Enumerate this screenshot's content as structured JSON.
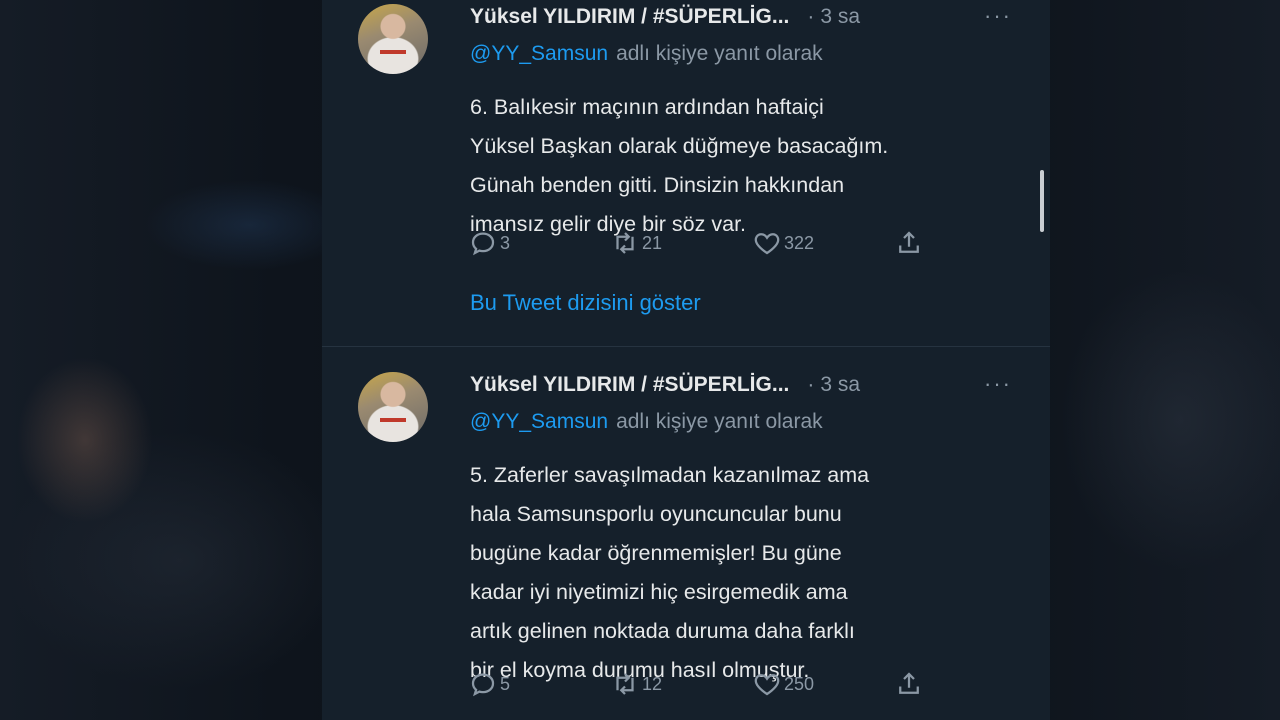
{
  "colors": {
    "panel_bg": "#15202b",
    "text_primary": "#e7e9ea",
    "text_secondary": "#8b98a5",
    "accent": "#1d9bf0"
  },
  "tweets": [
    {
      "author": "Yüksel YILDIRIM / #SÜPERLİG...",
      "dot": "·",
      "time": "3 sa",
      "more_icon": "more-horizontal-icon",
      "mention": "@YY_Samsun",
      "reply_suffix": "adlı kişiye yanıt olarak",
      "lines": [
        "6. Balıkesir maçının ardından haftaiçi",
        "Yüksel Başkan olarak düğmeye basacağım.",
        "Günah benden gitti. Dinsizin hakkından",
        "imansız gelir diye bir söz var."
      ],
      "replies": "3",
      "retweets": "21",
      "likes": "322",
      "show_thread": "Bu Tweet dizisini göster"
    },
    {
      "author": "Yüksel YILDIRIM / #SÜPERLİG...",
      "dot": "·",
      "time": "3 sa",
      "more_icon": "more-horizontal-icon",
      "mention": "@YY_Samsun",
      "reply_suffix": "adlı kişiye yanıt olarak",
      "lines": [
        "5. Zaferler savaşılmadan kazanılmaz ama",
        "hala Samsunsporlu oyuncuncular bunu",
        "bugüne kadar öğrenmemişler! Bu güne",
        "kadar iyi niyetimizi hiç esirgemedik ama",
        "artık gelinen noktada duruma daha farklı",
        "bir el koyma durumu hasıl olmuştur."
      ],
      "replies": "5",
      "retweets": "12",
      "likes": "250"
    }
  ]
}
